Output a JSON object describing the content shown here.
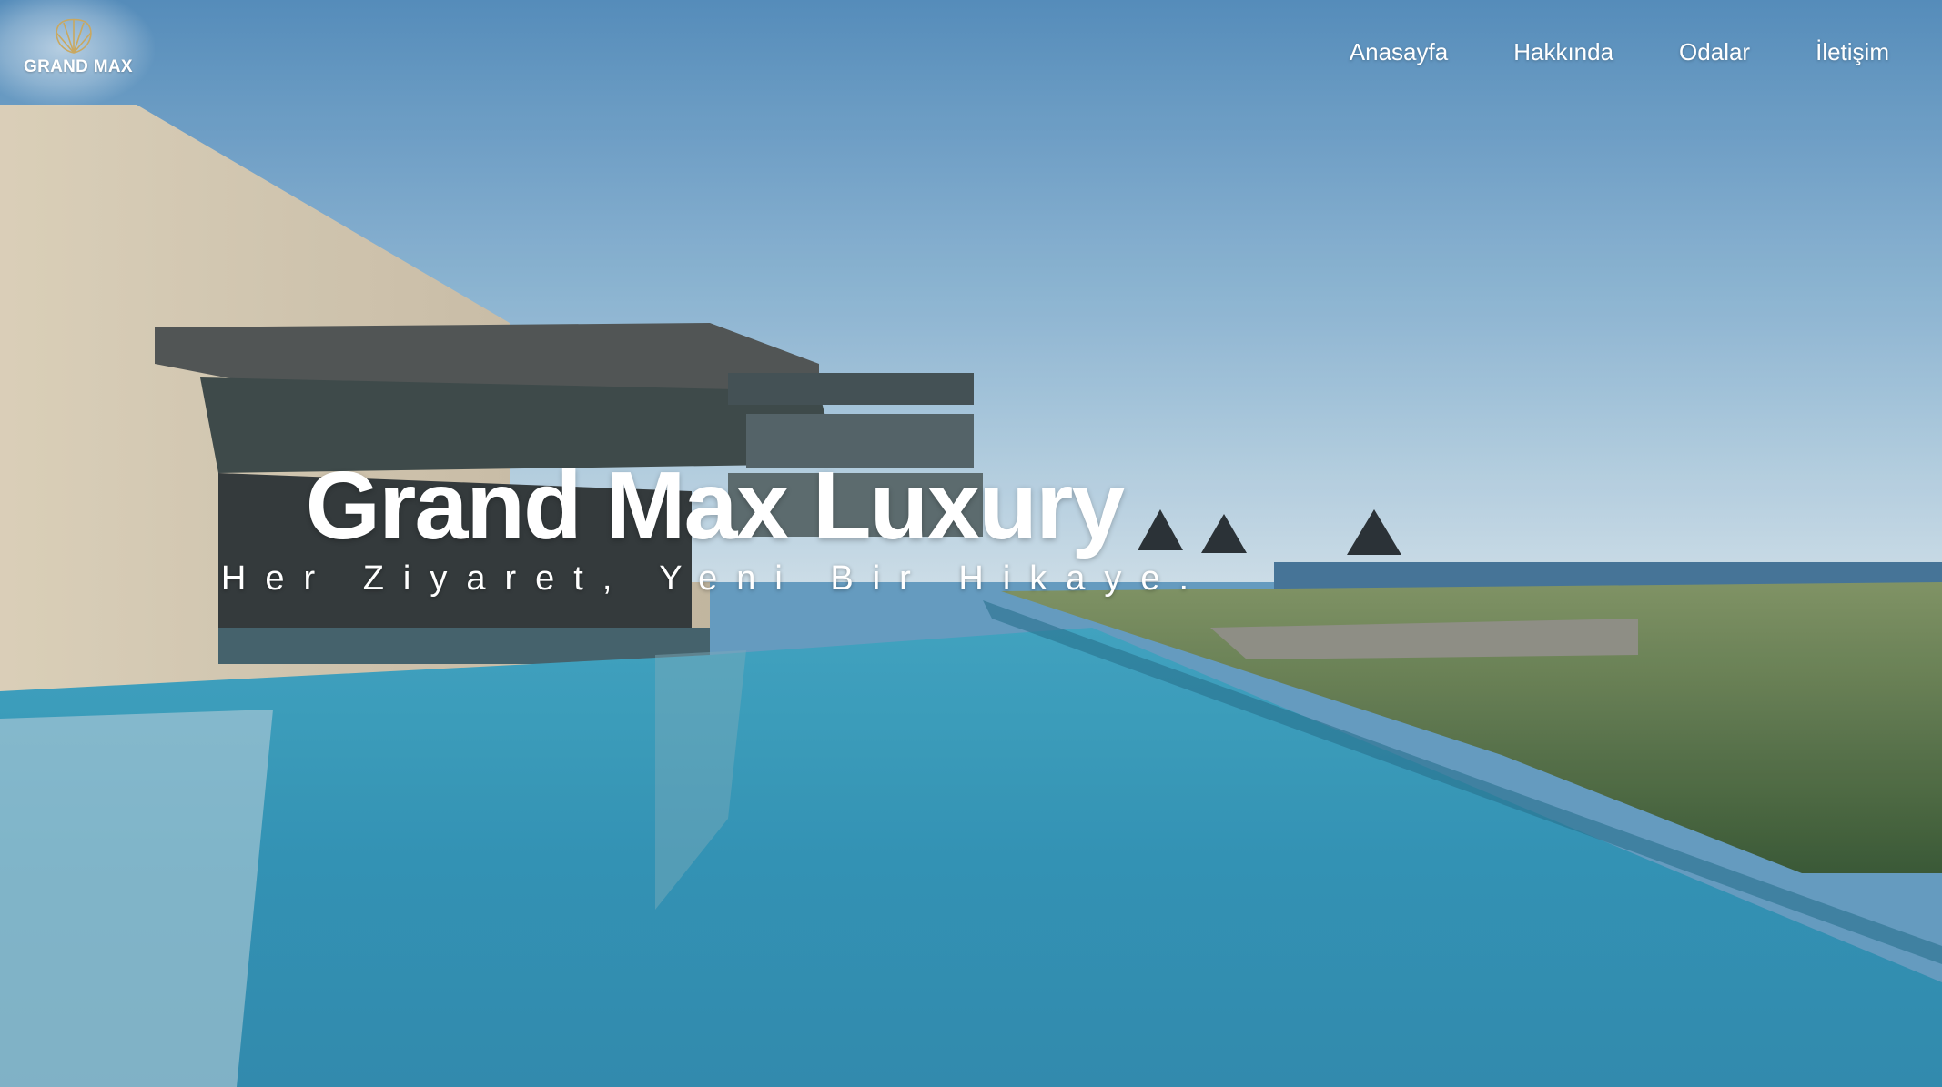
{
  "header": {
    "logo_text": "GRAND MAX",
    "nav": [
      "Anasayfa",
      "Hakkında",
      "Odalar",
      "İletişim"
    ]
  },
  "hero": {
    "title": "Grand Max Luxury",
    "subtitle": "Her Ziyaret, Yeni Bir Hikaye."
  },
  "icons": {
    "logo": "shell-icon"
  },
  "colors": {
    "sky_top": "#5a92c0",
    "sky_horizon": "#bcd4e2",
    "pool": "#2a8db2",
    "accent_gold": "#c9a860",
    "text": "#ffffff"
  }
}
